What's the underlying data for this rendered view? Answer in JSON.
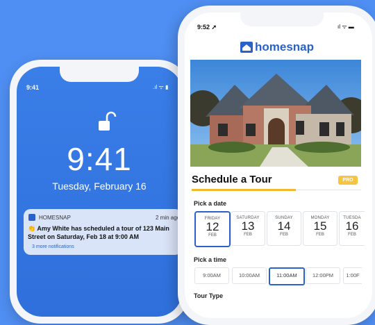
{
  "lock": {
    "status_time": "9:41",
    "status_icons": ".ıl ᯤ ▮",
    "time": "9:41",
    "date": "Tuesday, February 16"
  },
  "notification": {
    "app": "HOMESNAP",
    "age": "2 min ago",
    "emoji": "👏",
    "message": "Amy White has scheduled a tour of 123 Main Street on Saturday, Feb 18 at 9:00 AM",
    "more": "3 more notifications"
  },
  "app": {
    "status_time": "9:52 ➚",
    "status_icons": "ıl ᯤ ▬",
    "brand": "homesnap",
    "section_title": "Schedule a Tour",
    "pro_badge": "PRO",
    "pick_date_label": "Pick a date",
    "dates": [
      {
        "dow": "FRIDAY",
        "day": "12",
        "mon": "FEB"
      },
      {
        "dow": "SATURDAY",
        "day": "13",
        "mon": "FEB"
      },
      {
        "dow": "SUNDAY",
        "day": "14",
        "mon": "FEB"
      },
      {
        "dow": "MONDAY",
        "day": "15",
        "mon": "FEB"
      },
      {
        "dow": "TUESDA",
        "day": "16",
        "mon": "FEB"
      }
    ],
    "pick_time_label": "Pick a time",
    "times": [
      "9:00AM",
      "10:00AM",
      "11:00AM",
      "12:00PM",
      "1:00F"
    ],
    "tour_type_label": "Tour Type"
  },
  "colors": {
    "background": "#4f8ef2",
    "accent": "#2b62c7",
    "underline": "#f3b82d",
    "pro": "#f7c441"
  }
}
